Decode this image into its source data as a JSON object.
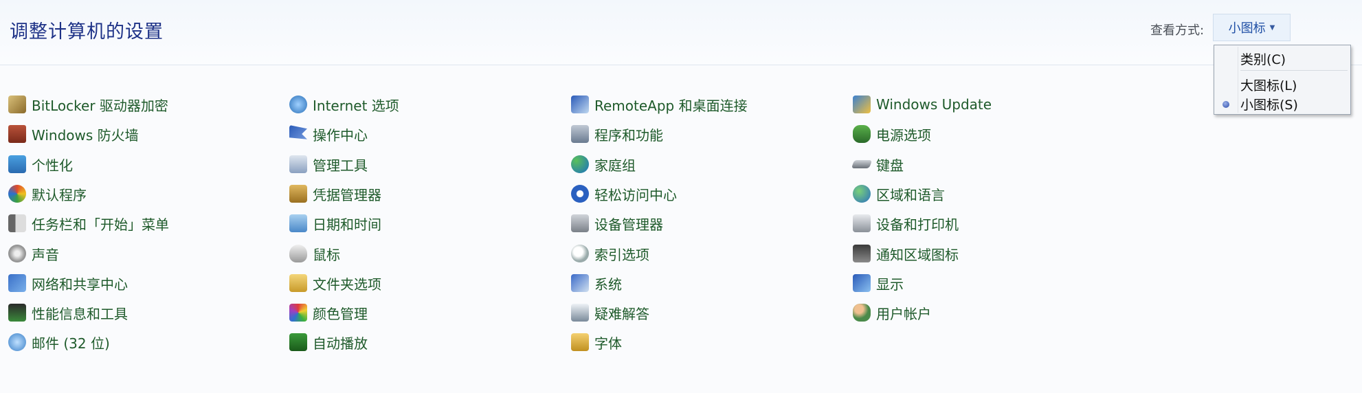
{
  "header": {
    "title": "调整计算机的设置",
    "view_label": "查看方式:",
    "view_value": "小图标"
  },
  "view_menu": {
    "items": [
      {
        "label": "类别(C)",
        "selected": false
      },
      {
        "label": "大图标(L)",
        "selected": false
      },
      {
        "label": "小图标(S)",
        "selected": true
      }
    ]
  },
  "columns": [
    [
      {
        "label": "BitLocker 驱动器加密",
        "icon": "bitlocker-icon"
      },
      {
        "label": "Windows 防火墙",
        "icon": "firewall-icon"
      },
      {
        "label": "个性化",
        "icon": "personalization-icon"
      },
      {
        "label": "默认程序",
        "icon": "default-programs-icon"
      },
      {
        "label": "任务栏和「开始」菜单",
        "icon": "taskbar-icon"
      },
      {
        "label": "声音",
        "icon": "sound-icon"
      },
      {
        "label": "网络和共享中心",
        "icon": "network-icon"
      },
      {
        "label": "性能信息和工具",
        "icon": "performance-icon"
      },
      {
        "label": "邮件 (32 位)",
        "icon": "mail-icon"
      }
    ],
    [
      {
        "label": "Internet 选项",
        "icon": "internet-options-icon"
      },
      {
        "label": "操作中心",
        "icon": "action-center-flag-icon"
      },
      {
        "label": "管理工具",
        "icon": "admin-tools-icon"
      },
      {
        "label": "凭据管理器",
        "icon": "credential-manager-icon"
      },
      {
        "label": "日期和时间",
        "icon": "date-time-icon"
      },
      {
        "label": "鼠标",
        "icon": "mouse-icon"
      },
      {
        "label": "文件夹选项",
        "icon": "folder-options-icon"
      },
      {
        "label": "颜色管理",
        "icon": "color-management-icon"
      },
      {
        "label": "自动播放",
        "icon": "autoplay-icon"
      }
    ],
    [
      {
        "label": "RemoteApp 和桌面连接",
        "icon": "remoteapp-icon"
      },
      {
        "label": "程序和功能",
        "icon": "programs-features-icon"
      },
      {
        "label": "家庭组",
        "icon": "homegroup-icon"
      },
      {
        "label": "轻松访问中心",
        "icon": "ease-of-access-icon"
      },
      {
        "label": "设备管理器",
        "icon": "device-manager-icon"
      },
      {
        "label": "索引选项",
        "icon": "indexing-icon"
      },
      {
        "label": "系统",
        "icon": "system-icon"
      },
      {
        "label": "疑难解答",
        "icon": "troubleshooting-icon"
      },
      {
        "label": "字体",
        "icon": "fonts-icon"
      }
    ],
    [
      {
        "label": "Windows Update",
        "icon": "windows-update-icon"
      },
      {
        "label": "电源选项",
        "icon": "power-options-icon"
      },
      {
        "label": "键盘",
        "icon": "keyboard-icon"
      },
      {
        "label": "区域和语言",
        "icon": "region-language-icon"
      },
      {
        "label": "设备和打印机",
        "icon": "devices-printers-icon"
      },
      {
        "label": "通知区域图标",
        "icon": "notification-area-icon"
      },
      {
        "label": "显示",
        "icon": "display-icon"
      },
      {
        "label": "用户帐户",
        "icon": "user-accounts-icon"
      }
    ]
  ],
  "colors": {
    "title": "#1e3287",
    "link": "#1e5a2a",
    "dropdown_text": "#1f4fa5"
  }
}
